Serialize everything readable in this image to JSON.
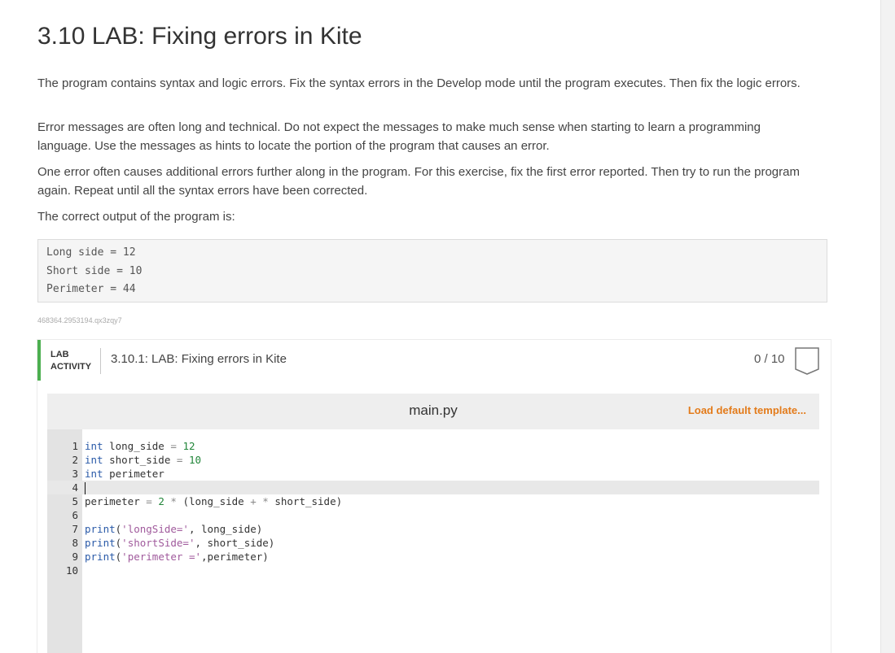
{
  "page": {
    "title": "3.10 LAB: Fixing errors in Kite",
    "paragraphs": [
      "The program contains syntax and logic errors. Fix the syntax errors in the Develop mode until the program executes. Then fix the logic errors.",
      "Error messages are often long and technical. Do not expect the messages to make much sense when starting to learn a programming language. Use the messages as hints to locate the portion of the program that causes an error.",
      "One error often causes additional errors further along in the program. For this exercise, fix the first error reported. Then try to run the program again. Repeat until all the syntax errors have been corrected.",
      "The correct output of the program is:"
    ],
    "expected_output": [
      "Long side = 12",
      "Short side = 10",
      "Perimeter = 44"
    ],
    "activity_id": "468364.2953194.qx3zqy7"
  },
  "lab": {
    "type_line1": "LAB",
    "type_line2": "ACTIVITY",
    "title": "3.10.1: LAB: Fixing errors in Kite",
    "score": "0 / 10",
    "accent_color": "#4caf50"
  },
  "editor": {
    "file_name": "main.py",
    "load_template_label": "Load default template...",
    "active_line": 4,
    "lines": [
      {
        "num": "1",
        "text": "int long_side = 12"
      },
      {
        "num": "2",
        "text": "int short_side = 10"
      },
      {
        "num": "3",
        "text": "int perimeter"
      },
      {
        "num": "4",
        "text": ""
      },
      {
        "num": "5",
        "text": "perimeter = 2 * (long_side + * short_side)"
      },
      {
        "num": "6",
        "text": ""
      },
      {
        "num": "7",
        "text": "print('longSide=', long_side)"
      },
      {
        "num": "8",
        "text": "print('shortSide=', short_side)"
      },
      {
        "num": "9",
        "text": "print('perimeter =',perimeter)"
      },
      {
        "num": "10",
        "text": ""
      }
    ]
  },
  "colors": {
    "link_orange": "#e37b1a",
    "keyword_blue": "#2a5aa8",
    "number_green": "#22863a",
    "string_purple": "#a05a9c"
  }
}
